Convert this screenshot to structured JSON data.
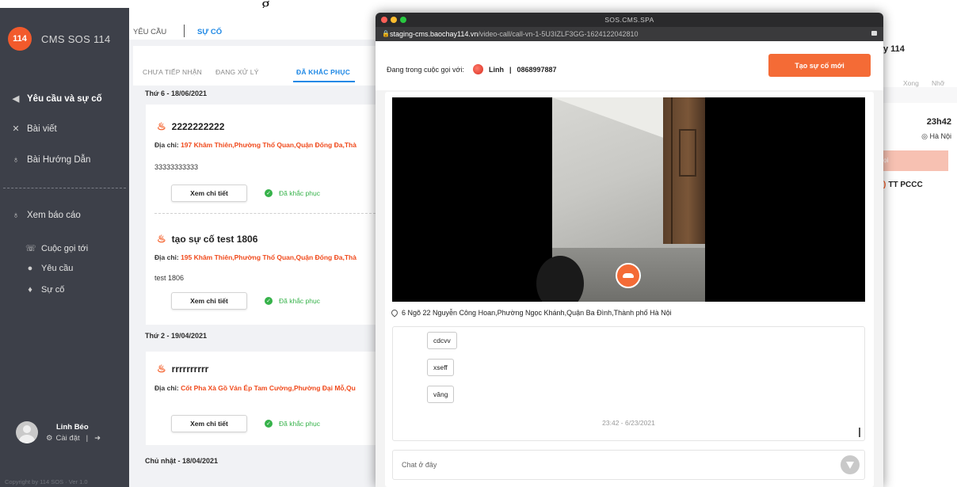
{
  "background": {
    "heading_fragment": "g"
  },
  "brand": {
    "badge": "114",
    "name": "CMS SOS 114"
  },
  "sidebar": {
    "items": [
      {
        "label": "Yêu cầu và sự cố",
        "icon": "megaphone-icon"
      },
      {
        "label": "Bài viết",
        "icon": "tools-icon"
      },
      {
        "label": "Bài Hướng Dẫn",
        "icon": "pin-icon"
      },
      {
        "label": "Xem báo cáo",
        "icon": "pin-icon"
      },
      {
        "label": "Cuộc gọi tới",
        "icon": "phone-incoming-icon"
      },
      {
        "label": "Yêu cầu",
        "icon": "chat-icon"
      },
      {
        "label": "Sự cố",
        "icon": "fire-icon"
      }
    ],
    "user": {
      "name": "Linh Béo",
      "settings": "Cài đặt",
      "separator": "|"
    },
    "copyright": "Copyright by 114 SOS · Ver 1.0"
  },
  "list": {
    "top_tabs": [
      "YÊU CẦU",
      "SỰ CỐ"
    ],
    "sub_tabs": [
      "CHƯA TIẾP NHẬN",
      "ĐANG XỬ LÝ",
      "ĐÃ KHẮC PHỤC"
    ],
    "days": [
      "Thứ 6 - 18/06/2021",
      "Thứ 2 - 19/04/2021",
      "Chủ nhật - 18/04/2021"
    ],
    "address_label": "Địa chỉ:",
    "detail_button": "Xem chi tiết",
    "status_label": "Đã khắc phục",
    "cards": [
      {
        "title": "2222222222",
        "address": "197 Khâm Thiên,Phường Thổ Quan,Quận Đống Đa,Thà",
        "desc": "33333333333"
      },
      {
        "title": "tạo sự cố test 1806",
        "address": "195 Khâm Thiên,Phường Thổ Quan,Quận Đống Đa,Thà",
        "desc": "test 1806"
      },
      {
        "title": "rrrrrrrrrr",
        "address": "Cốt Pha Xà Gồ Ván Ép Tam Cường,Phường Đại Mỗ,Qu",
        "desc": ""
      }
    ]
  },
  "right_panel": {
    "title_fragment": "y 114",
    "tabs": [
      "Xong",
      "Nhỡ"
    ],
    "time": "23h42",
    "location": "Hà Nội",
    "button_fragment": "ọi",
    "unit": "TT PCCC"
  },
  "popup": {
    "window_title": "SOS.CMS.SPA",
    "url_host": "staging-cms.baochay114.vn",
    "url_path": "/video-call/call-vn-1-5U3IZLF3GG-1624122042810",
    "call_label": "Đang trong cuộc gọi với:",
    "caller_name": "Linh",
    "separator": "|",
    "caller_phone": "0868997887",
    "new_incident_button": "Tạo sự cố mới",
    "address": "6 Ngõ 22 Nguyễn Công Hoan,Phường Ngọc Khánh,Quận Ba Đình,Thành phố Hà Nội",
    "messages": [
      "cdcvv",
      "xseff",
      "vâng"
    ],
    "message_time": "23:42 - 6/23/2021",
    "chat_placeholder": "Chat ở đây",
    "colors": {
      "accent": "#f46b36",
      "close": "#ff5f57",
      "minimize": "#febc2e",
      "maximize": "#28c840"
    }
  }
}
